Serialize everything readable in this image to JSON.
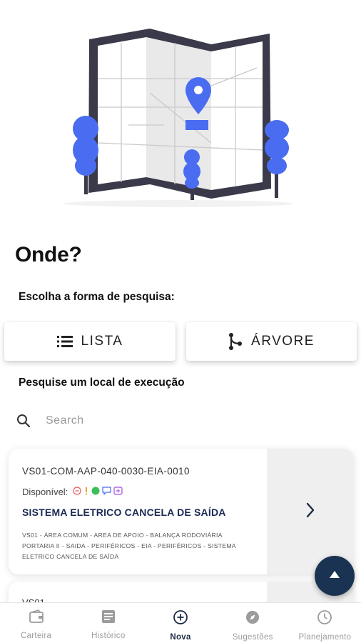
{
  "page": {
    "title": "Onde?",
    "subtitle": "Escolha a forma de pesquisa:"
  },
  "modes": {
    "list_label": "LISTA",
    "tree_label": "ÁRVORE"
  },
  "search": {
    "title": "Pesquise um local de execução",
    "placeholder": "Search"
  },
  "results": [
    {
      "code": "VS01-COM-AAP-040-0030-EIA-0010",
      "availability_label": "Disponível:",
      "name": "SISTEMA ELETRICO CANCELA DE SAÍDA",
      "path": "VS01 - ÁREA COMUM - AREA DE APOIO - BALANÇA RODOVIÁRIA PORTARIA II - SAIDA - PERIFÉRICOS - EIA - PERIFÉRICOS - SISTEMA ELETRICO CANCELA DE SAÍDA"
    },
    {
      "code": "VS01"
    }
  ],
  "nav": {
    "items": [
      {
        "label": "Carteira",
        "icon": "wallet-icon"
      },
      {
        "label": "Histórico",
        "icon": "history-icon"
      },
      {
        "label": "Nova",
        "icon": "add-circle-icon",
        "active": true
      },
      {
        "label": "Sugestões",
        "icon": "compass-icon"
      },
      {
        "label": "Planejamento",
        "icon": "clock-icon"
      }
    ]
  },
  "colors": {
    "accent": "#4a6cf0",
    "navy": "#1b3352",
    "title_navy": "#1a2a55"
  }
}
